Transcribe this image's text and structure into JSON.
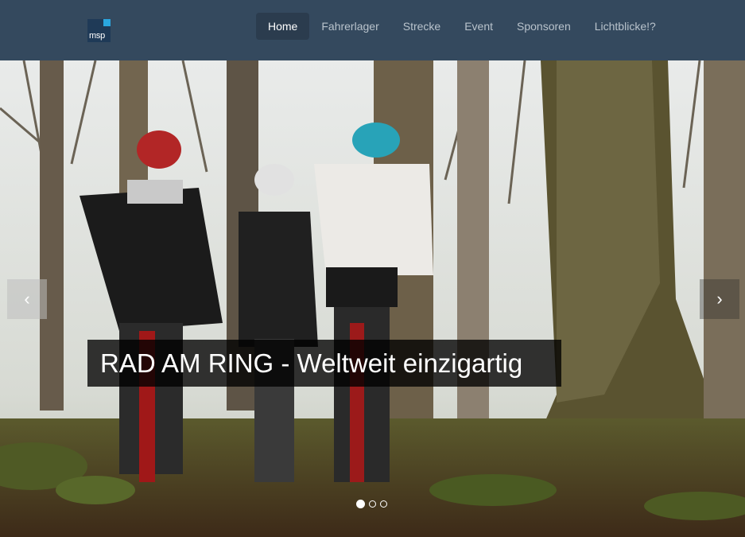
{
  "logo": {
    "text": "msp"
  },
  "nav": {
    "items": [
      {
        "label": "Home",
        "active": true
      },
      {
        "label": "Fahrerlager",
        "active": false
      },
      {
        "label": "Strecke",
        "active": false
      },
      {
        "label": "Event",
        "active": false
      },
      {
        "label": "Sponsoren",
        "active": false
      },
      {
        "label": "Lichtblicke!?",
        "active": false
      }
    ]
  },
  "carousel": {
    "caption": "RAD AM RING - Weltweit einzigartig",
    "prev_icon": "chevron-left-icon",
    "next_icon": "chevron-right-icon",
    "prev_glyph": "‹",
    "next_glyph": "›",
    "slides_total": 3,
    "active_slide": 1
  },
  "colors": {
    "navbar": "#34495e",
    "nav_active": "#2b3c4e",
    "nav_text": "#b9c3cc",
    "logo_accent": "#2aa7e0"
  }
}
